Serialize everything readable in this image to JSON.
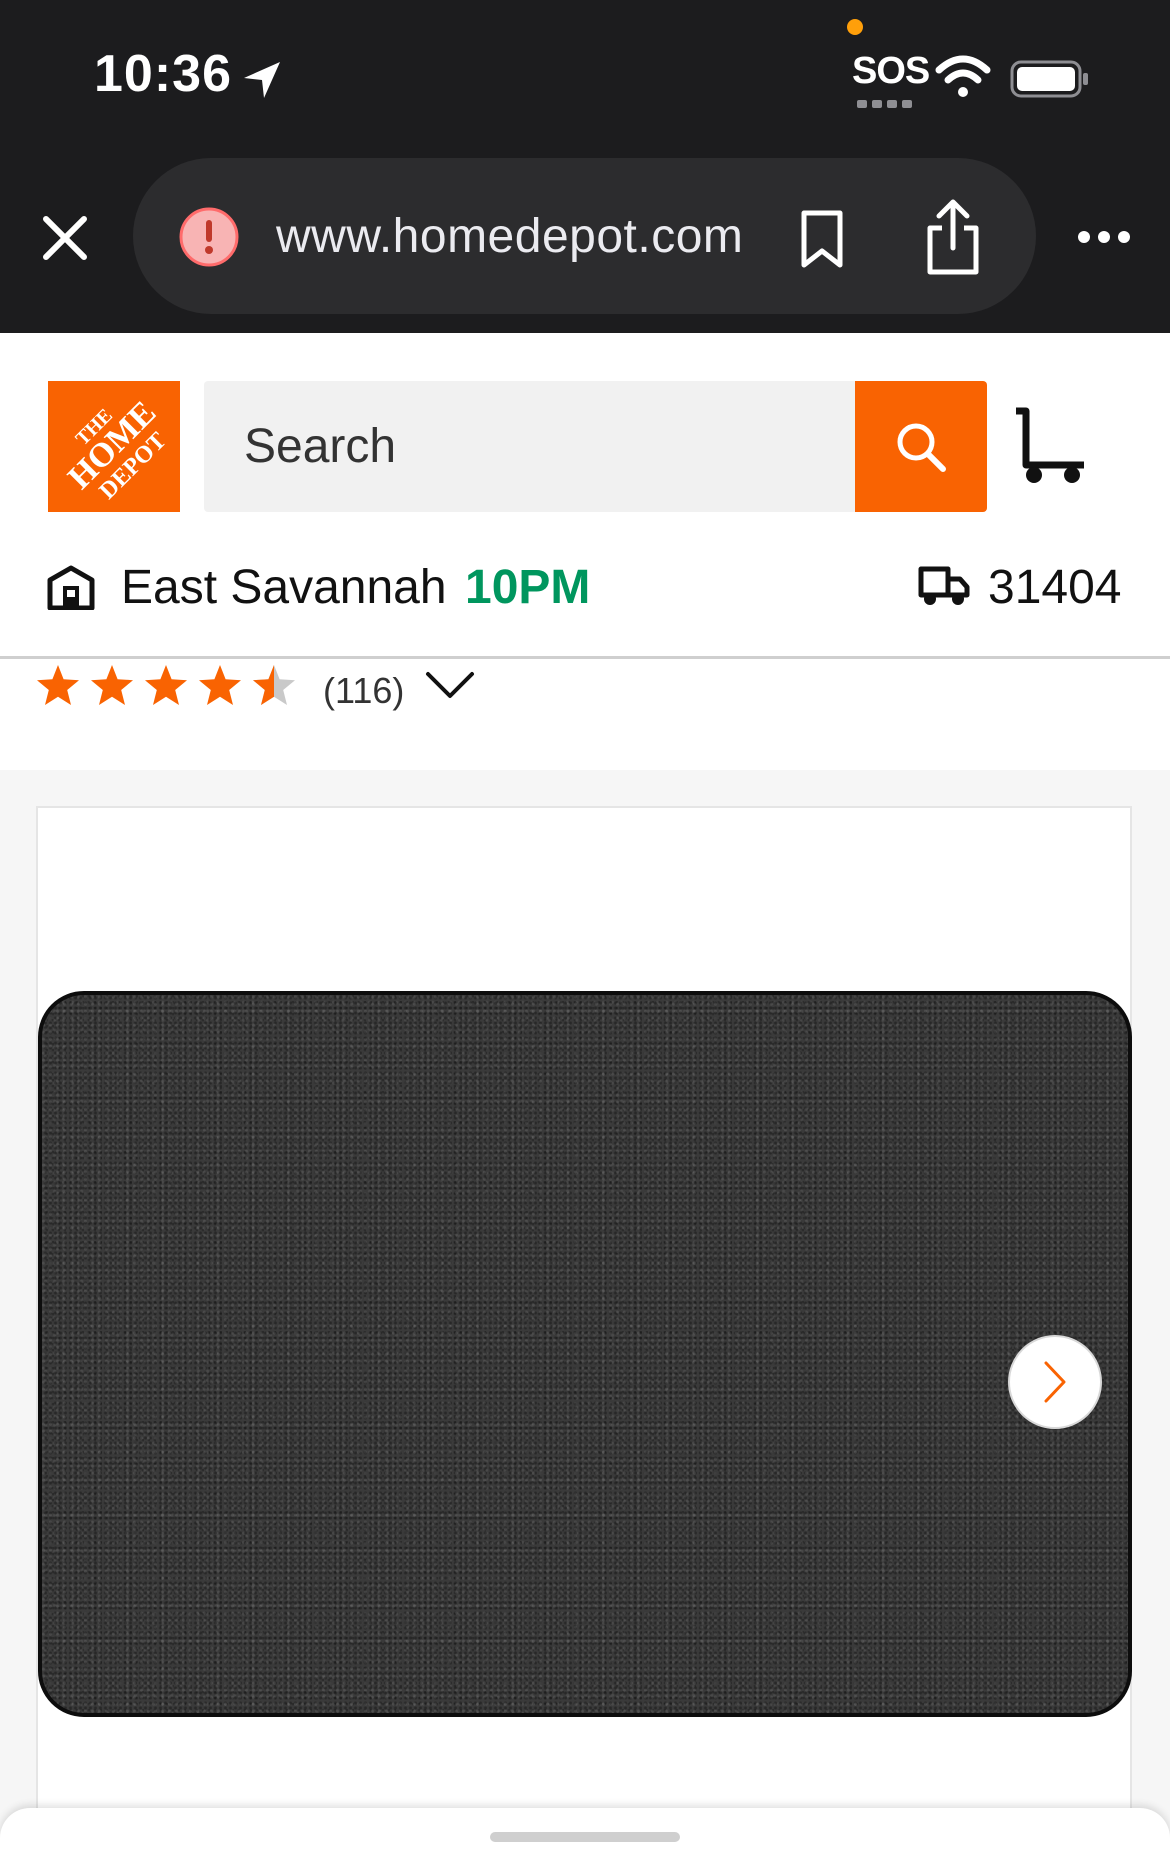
{
  "status_bar": {
    "time": "10:36",
    "sos": "SOS",
    "icons": [
      "location-arrow-icon",
      "wifi-icon",
      "battery-icon"
    ]
  },
  "browser": {
    "url": "www.homedepot.com",
    "icons": [
      "close-icon",
      "warning-icon",
      "bookmark-icon",
      "share-icon",
      "more-icon"
    ]
  },
  "header": {
    "logo_text": "THE HOME DEPOT",
    "search": {
      "placeholder": "Search"
    },
    "cart_icon": "cart-icon"
  },
  "store": {
    "name": "East Savannah",
    "hours": "10PM",
    "zip": "31404"
  },
  "rating": {
    "stars": 4.5,
    "count": "(116)"
  },
  "gallery": {
    "next_icon": "chevron-right-icon"
  },
  "colors": {
    "brand": "#f96302",
    "open_hours": "#00965e",
    "chrome": "#1c1c1e"
  }
}
